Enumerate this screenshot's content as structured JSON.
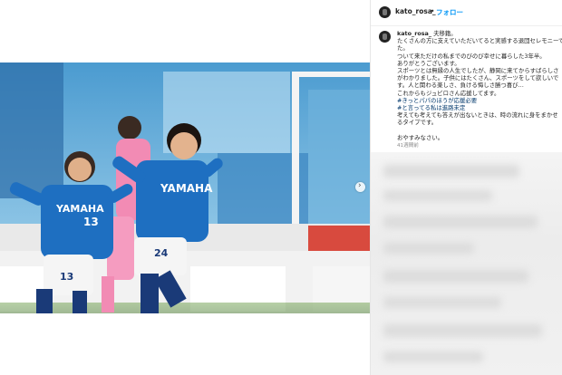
{
  "header": {
    "username": "kato_rosa_",
    "separator": "•",
    "follow_label": "フォロー"
  },
  "caption": {
    "username": "kato_rosa_",
    "first_line": "夫移籍。",
    "lines": [
      "たくさんの方に支えていただいてると実感する退団セレモニーでし",
      "た。",
      "ついて来ただけの私までのびのび幸せに暮らした3年半。",
      "ありがとうございます。",
      "スポーツとは無縁の人生でしたが、静岡に来てからすばらしさ",
      "がわかりました。子供にはたくさん、スポーツをして欲しいで",
      "す。人と関わる楽しさ、負ける悔しさ勝つ喜び…",
      "これからもジュビロさん応援してます。"
    ],
    "hashtags": [
      "#きっとパパのほうが応援必要",
      "#と言ってる私は進路未定"
    ],
    "closing_lines": [
      "考えても考えても答えが出ないときは、時の流れに身をまかせ",
      "るタイプです。"
    ],
    "good_night": "おやすみなさい。"
  },
  "post_time": "41週間前",
  "photo": {
    "jersey_sponsor_left": "YAMAHA",
    "jersey_sponsor_right": "YAMAHA",
    "jersey_number_left": "13",
    "jersey_number_right": "24",
    "sleeve_number": "13"
  },
  "colors": {
    "follow": "#0095f6",
    "hashtag": "#00376b",
    "jubilo_blue": "#1e6fc1",
    "pink_opponent": "#f28bb4"
  },
  "icons": {
    "next": "chevron-right-icon"
  }
}
